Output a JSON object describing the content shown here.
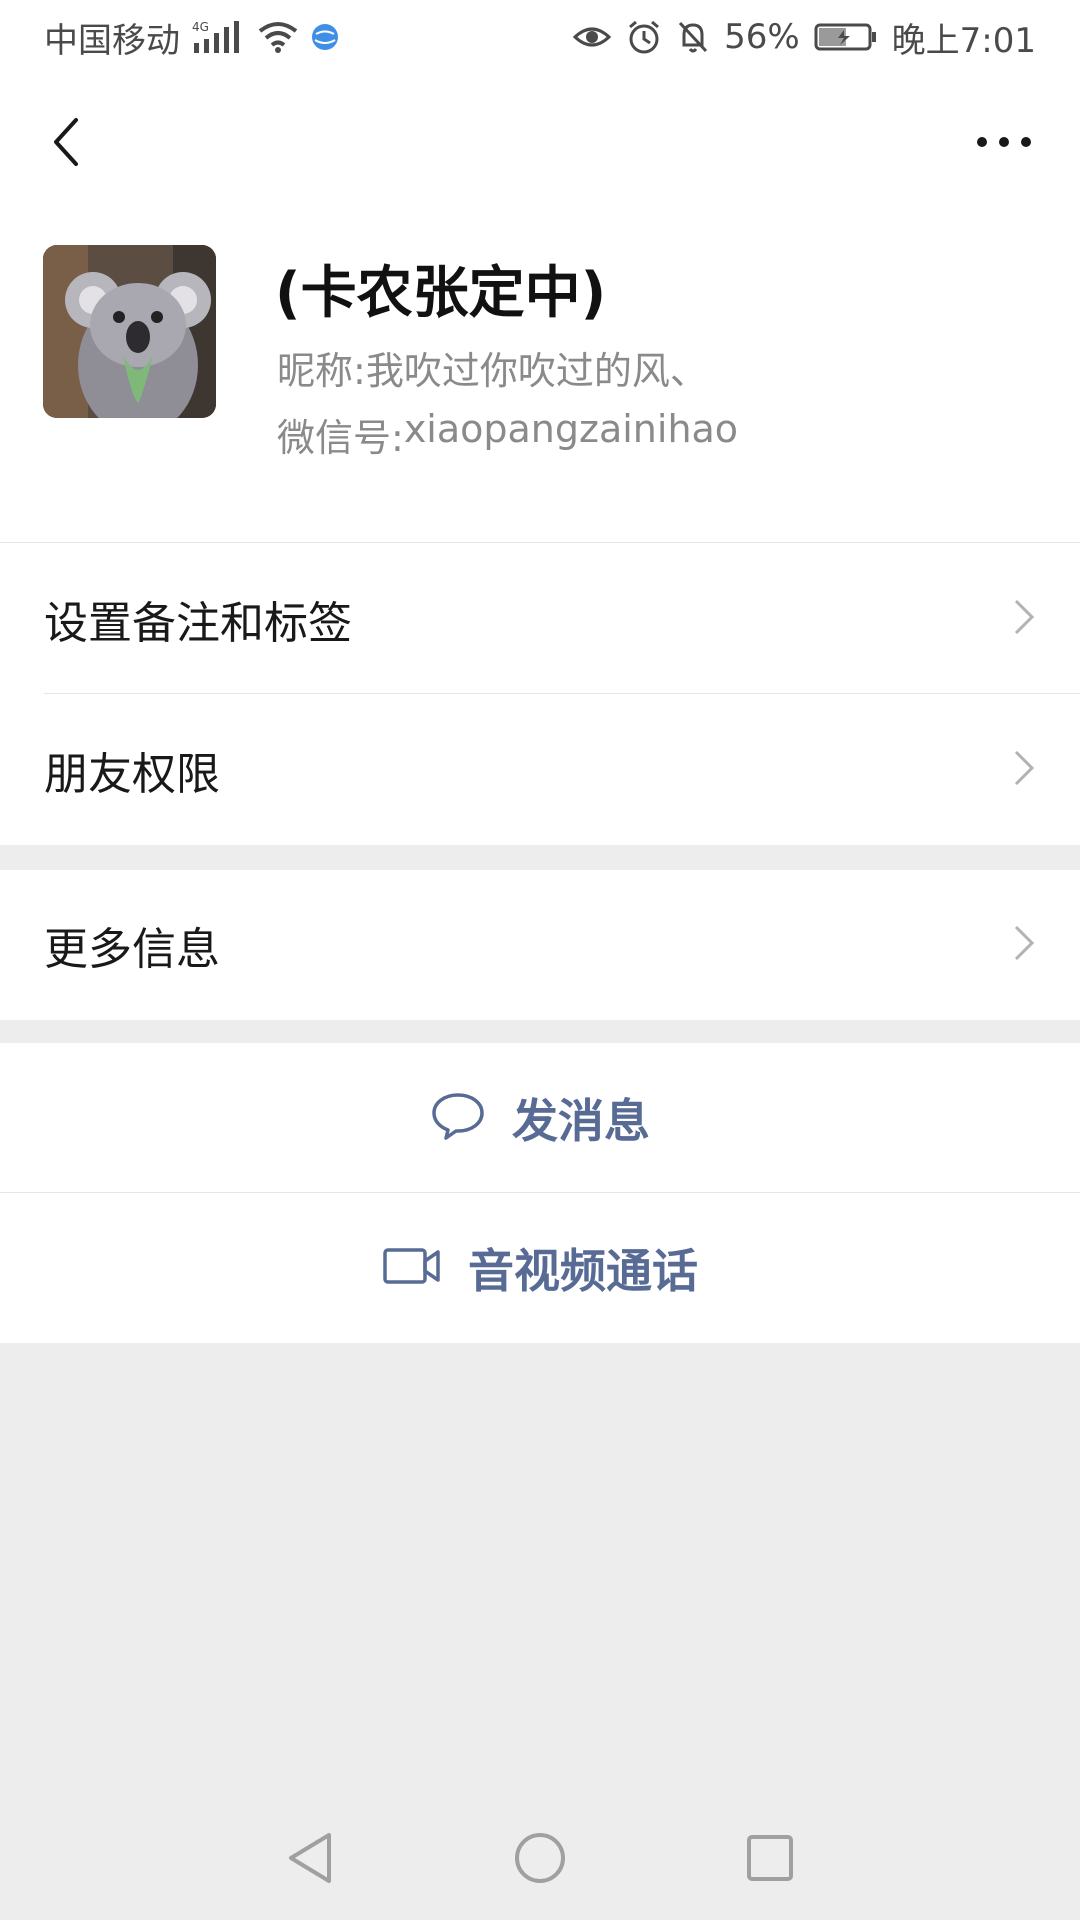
{
  "status_bar": {
    "carrier": "中国移动",
    "network_badge": "4G",
    "battery_percent": "56%",
    "time": "晚上7:01",
    "icons": [
      "signal-icon",
      "wifi-icon",
      "vpn-globe-icon",
      "eye-comfort-icon",
      "alarm-icon",
      "mute-icon",
      "battery-icon"
    ],
    "battery_level": 0.56
  },
  "profile": {
    "display_name": "(卡农张定中)",
    "nickname_label": "昵称:",
    "nickname_value": "我吹过你吹过的风、",
    "wechat_id_label": "微信号:",
    "wechat_id_value": "xiaopangzainihao"
  },
  "menu": {
    "group1": [
      {
        "label": "设置备注和标签"
      },
      {
        "label": "朋友权限"
      }
    ],
    "group2": [
      {
        "label": "更多信息"
      }
    ]
  },
  "actions": {
    "message_label": "发消息",
    "call_label": "音视频通话"
  },
  "colors": {
    "accent_link": "#576b95",
    "background": "#ededed",
    "card": "#ffffff"
  }
}
